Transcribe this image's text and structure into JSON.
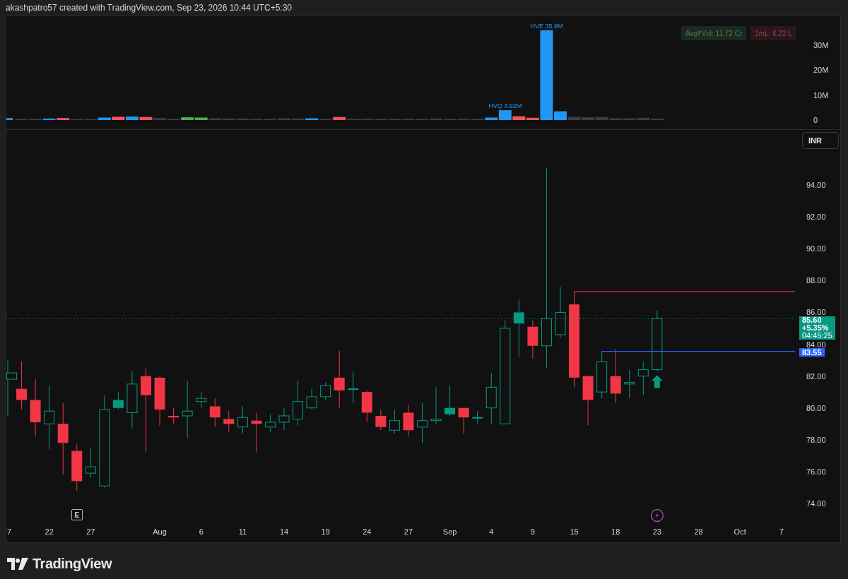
{
  "header": {
    "text": "akashpatro57 created with TradingView.com, Sep 23, 2026 10:44 UTC+5:30"
  },
  "volume_pane": {
    "badges": [
      {
        "text": "Avg₹Vol: 11.72 Cr",
        "color": "#1b2a1f"
      },
      {
        "text": "1mL: 6.22 L",
        "color": "#2c171a"
      }
    ],
    "bar_labels": [
      "HVQ 3.92M",
      "HVE 35.9M"
    ],
    "axis_labels": [
      "30M",
      "20M",
      "10M",
      "0"
    ]
  },
  "price_pane": {
    "currency_button": "INR",
    "axis_labels": [
      "94.00",
      "92.00",
      "90.00",
      "88.00",
      "86.00",
      "84.00",
      "82.00",
      "80.00",
      "78.00",
      "76.00",
      "74.00"
    ],
    "time_labels": [
      "7",
      "22",
      "27",
      "Aug",
      "6",
      "11",
      "14",
      "19",
      "24",
      "27",
      "Sep",
      "4",
      "9",
      "15",
      "18",
      "23",
      "28",
      "Oct",
      "7"
    ],
    "level_label": "83.55",
    "last_price": {
      "price": "85.60",
      "change": "+5.35%",
      "countdown": "04:45:25"
    },
    "earnings_marker": "E"
  },
  "footer": {
    "logo_text": "TradingView"
  }
}
